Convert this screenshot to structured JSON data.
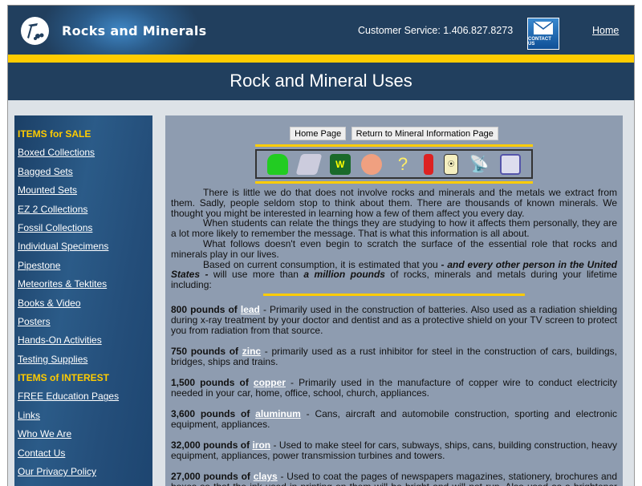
{
  "header": {
    "logo_text": "Rocks and Minerals",
    "customer_service": "Customer Service: 1.406.827.8273",
    "contact_label": "CONTACT US",
    "home_link": "Home"
  },
  "page_title": "Rock and Mineral Uses",
  "sidebar": {
    "heading_sale": "ITEMS for SALE",
    "sale_items": [
      "Boxed Collections",
      "Bagged Sets",
      "Mounted Sets",
      "EZ 2 Collections",
      "Fossil Collections",
      "Individual Specimens",
      "Pipestone",
      "Meteorites & Tektites",
      "Books & Video",
      "Posters",
      "Hands-On Activities",
      "Testing Supplies"
    ],
    "heading_interest": "ITEMS of INTEREST",
    "interest_items": [
      "FREE Education Pages",
      "Links",
      "Who We Are",
      "Contact Us",
      "Our Privacy Policy"
    ]
  },
  "main": {
    "buttons": {
      "home": "Home Page",
      "return": "Return to Mineral Information Page"
    },
    "icons": [
      "car-icon",
      "fax-machine-icon",
      "book-icon",
      "airplane-icon",
      "light-bulb-icon",
      "soda-can-icon",
      "electrical-outlet-icon",
      "satellite-dish-icon",
      "computer-icon"
    ],
    "intro": [
      "There is little we do that does not involve rocks and minerals and the metals we extract from them. Sadly, people seldom stop to think about them. There are thousands of known minerals. We thought you might be interested in learning how a few of them affect you every day.",
      "When students can relate the things they are studying to how it affects them personally, they are a lot more likely to remember the message. That is what this information is all about.",
      "What follows doesn't even begin to scratch the surface of the essential role that rocks and minerals play in our lives."
    ],
    "intro4": {
      "a": "Based on current consumption, it is estimated that you ",
      "b": "- and every other person in the United States -",
      "c": " will use more than ",
      "d": "a million pounds",
      "e": " of rocks, minerals and metals during your lifetime including:"
    },
    "entries": [
      {
        "amount": "800 pounds of ",
        "mineral": "lead",
        "text": " - Primarily used in the construction of batteries. Also used as a radiation shielding during x-ray treatment by your doctor and dentist and as a protective shield on your TV screen to protect you from radiation from that source."
      },
      {
        "amount": "750 pounds of ",
        "mineral": "zinc",
        "text": " - primarily used as a rust inhibitor for steel in the construction of cars, buildings, bridges, ships and trains."
      },
      {
        "amount": "1,500 pounds of ",
        "mineral": "copper",
        "text": " - Primarily used in the manufacture of copper wire to conduct electricity needed in your car, home, office, school, church, appliances."
      },
      {
        "amount": "3,600 pounds of ",
        "mineral": "aluminum",
        "text": " - Cans, aircraft and automobile construction, sporting and electronic equipment, appliances."
      },
      {
        "amount": "32,000 pounds of ",
        "mineral": "iron",
        "text": " - Used to make steel for cars, subways, ships, cans, building construction, heavy equipment, appliances, power transmission turbines and towers."
      },
      {
        "amount": "27,000 pounds of ",
        "mineral": "clays",
        "text": " - Used to coat the pages of newspapers magazines, stationery, brochures and boxes so that the ink used in printing on them will be bright and will not run. Also used as a brightener and abrasive in toothpaste and to provide a smooth coating for your stomach in medicines."
      }
    ]
  },
  "colors": {
    "navy": "#213f5e",
    "yellow": "#ffcc00",
    "panel": "#8e9cb0"
  }
}
